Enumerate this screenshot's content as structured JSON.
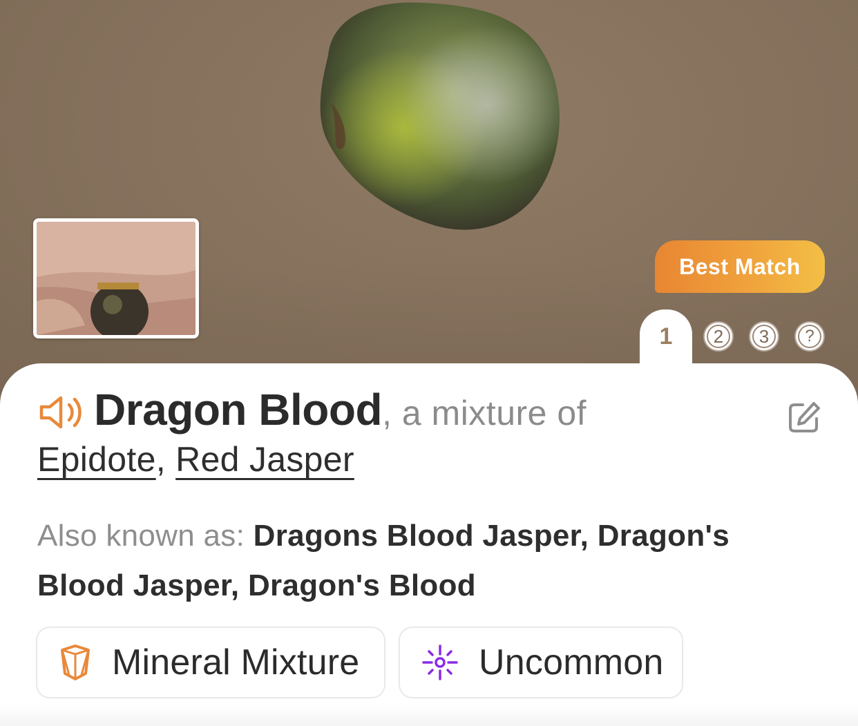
{
  "hero": {
    "badge_label": "Best Match",
    "pages": [
      "1",
      "2",
      "3",
      "?"
    ],
    "active_page": "1"
  },
  "result": {
    "name": "Dragon Blood",
    "suffix": ", a mixture of",
    "components": [
      "Epidote",
      "Red Jasper"
    ],
    "separator": ",",
    "aka_label": "Also known as:",
    "aka_values": "Dragons Blood Jasper, Dragon's Blood Jasper, Dragon's Blood"
  },
  "chips": [
    {
      "label": "Mineral Mixture",
      "icon": "crystal-icon"
    },
    {
      "label": "Uncommon",
      "icon": "sparkle-icon"
    }
  ],
  "icons": {
    "speaker": "speaker-icon",
    "edit": "edit-icon"
  },
  "colors": {
    "accent_orange": "#e8893a",
    "badge_gradient_start": "#e88633",
    "badge_gradient_end": "#f3bf45",
    "rarity_purple": "#8a2be2",
    "text_dark": "#2b2b2b",
    "text_muted": "#8b8b8b"
  }
}
